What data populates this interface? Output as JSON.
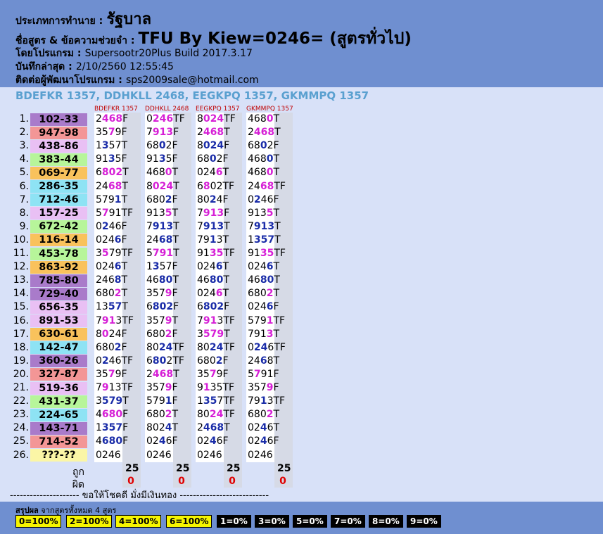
{
  "header": {
    "bet_label": "ประเภทการทำนาย :",
    "bet_value": "รัฐบาล",
    "formula_label": "ชื่อสูตร & ข้อความช่วยจำ :",
    "formula_value": "TFU By Kiew=0246= (สูตรทั่วไป)",
    "program_label": "โดยโปรแกรม :",
    "program_value": "Supersootr20Plus Build 2017.3.17",
    "saved_label": "บันทึกล่าสุด :",
    "saved_value": "2/10/2560 12:55:45",
    "contact_label": "ติดต่อผู้พัฒนาโปรแกรม :",
    "contact_value": "sps2009sale@hotmail.com"
  },
  "formula_line": "BDEFKR 1357, DDHKLL 2468, EEGKPQ 1357, GKMMPQ 1357",
  "columns": [
    "BDEFKR 1357",
    "DDHKLL 2468",
    "EEGKPQ 1357",
    "GKMMPQ 1357"
  ],
  "colors": {
    "pink": "#e9c0f4",
    "red": "#f39696",
    "green": "#b7f59a",
    "orange": "#f9c25c",
    "purple": "#a97bca",
    "cyan": "#8ee3f4",
    "yellow": "#fbf6a6"
  },
  "rows": [
    {
      "idx": "1.",
      "num": "102-33",
      "color": "purple",
      "cells": [
        [
          "2",
          "468",
          "F"
        ],
        [
          "0",
          "246",
          "TF"
        ],
        [
          "8",
          "024",
          "TF"
        ],
        [
          "468",
          "0",
          "T"
        ]
      ]
    },
    {
      "idx": "2.",
      "num": "947-98",
      "color": "red",
      "cells": [
        [
          "35",
          "7",
          "9F"
        ],
        [
          "7",
          "913",
          "F"
        ],
        [
          "2",
          "468",
          "T"
        ],
        [
          "2",
          "468",
          "T"
        ]
      ]
    },
    {
      "idx": "3.",
      "num": "438-86",
      "color": "pink",
      "cells": [
        [
          "1",
          "3",
          "57T"
        ],
        [
          "68",
          "0",
          "2F"
        ],
        [
          "8",
          "024",
          "F"
        ],
        [
          "68",
          "0",
          "2F"
        ]
      ]
    },
    {
      "idx": "4.",
      "num": "383-44",
      "color": "green",
      "cells": [
        [
          "91",
          "3",
          "5F"
        ],
        [
          "91",
          "3",
          "5F"
        ],
        [
          "68",
          "0",
          "2F"
        ],
        [
          "468",
          "0",
          "T"
        ]
      ]
    },
    {
      "idx": "5.",
      "num": "069-77",
      "color": "orange",
      "cells": [
        [
          "6",
          "802",
          "T"
        ],
        [
          "468",
          "0",
          "T"
        ],
        [
          "024",
          "6",
          "T"
        ],
        [
          "468",
          "0",
          "T"
        ]
      ]
    },
    {
      "idx": "6.",
      "num": "286-35",
      "color": "cyan",
      "cells": [
        [
          "24",
          "68",
          "T"
        ],
        [
          "8",
          "024",
          "T"
        ],
        [
          "6",
          "8",
          "02TF"
        ],
        [
          "24",
          "68",
          "TF"
        ]
      ]
    },
    {
      "idx": "7.",
      "num": "712-46",
      "color": "cyan",
      "cells": [
        [
          "579",
          "1",
          "T"
        ],
        [
          "680",
          "2",
          "F"
        ],
        [
          "80",
          "2",
          "4F"
        ],
        [
          "0",
          "2",
          "46F"
        ]
      ]
    },
    {
      "idx": "8.",
      "num": "157-25",
      "color": "pink",
      "cells": [
        [
          "5",
          "7",
          "91TF"
        ],
        [
          "913",
          "5",
          "T"
        ],
        [
          "7",
          "913",
          "F"
        ],
        [
          "913",
          "5",
          "T"
        ]
      ]
    },
    {
      "idx": "9.",
      "num": "672-42",
      "color": "green",
      "cells": [
        [
          "0",
          "2",
          "46F"
        ],
        [
          "7",
          "913",
          "T"
        ],
        [
          "7",
          "913",
          "T"
        ],
        [
          "7",
          "913",
          "T"
        ]
      ]
    },
    {
      "idx": "10.",
      "num": "116-14",
      "color": "orange",
      "cells": [
        [
          "024",
          "6",
          "F"
        ],
        [
          "24",
          "68",
          "T"
        ],
        [
          "79",
          "1",
          "3T"
        ],
        [
          "1",
          "357",
          "T"
        ]
      ]
    },
    {
      "idx": "11.",
      "num": "453-78",
      "color": "green",
      "cells": [
        [
          "3",
          "5",
          "79TF"
        ],
        [
          "5",
          "791",
          "T"
        ],
        [
          "91",
          "35",
          "TF"
        ],
        [
          "91",
          "35",
          "TF"
        ]
      ]
    },
    {
      "idx": "12.",
      "num": "863-92",
      "color": "orange",
      "cells": [
        [
          "024",
          "6",
          "T"
        ],
        [
          "1",
          "3",
          "57F"
        ],
        [
          "024",
          "6",
          "T"
        ],
        [
          "024",
          "6",
          "T"
        ]
      ]
    },
    {
      "idx": "13.",
      "num": "785-80",
      "color": "purple",
      "cells": [
        [
          "246",
          "8",
          "T"
        ],
        [
          "46",
          "80",
          "T"
        ],
        [
          "46",
          "80",
          "T"
        ],
        [
          "46",
          "80",
          "T"
        ]
      ]
    },
    {
      "idx": "14.",
      "num": "729-40",
      "color": "purple",
      "cells": [
        [
          "680",
          "2",
          "T"
        ],
        [
          "357",
          "9",
          "F"
        ],
        [
          "024",
          "6",
          "T"
        ],
        [
          "680",
          "2",
          "T"
        ]
      ]
    },
    {
      "idx": "15.",
      "num": "656-35",
      "color": "pink",
      "cells": [
        [
          "13",
          "57",
          "T"
        ],
        [
          "6",
          "802",
          "F"
        ],
        [
          "6",
          "802",
          "F"
        ],
        [
          "024",
          "6",
          "F"
        ]
      ]
    },
    {
      "idx": "16.",
      "num": "891-53",
      "color": "pink",
      "cells": [
        [
          "7",
          "91",
          "3TF"
        ],
        [
          "357",
          "9",
          "T"
        ],
        [
          "7",
          "91",
          "3TF"
        ],
        [
          "579",
          "1",
          "TF"
        ]
      ]
    },
    {
      "idx": "17.",
      "num": "630-61",
      "color": "orange",
      "cells": [
        [
          "8",
          "0",
          "24F"
        ],
        [
          "680",
          "2",
          "F"
        ],
        [
          "3",
          "579",
          "T"
        ],
        [
          "791",
          "3",
          "T"
        ]
      ]
    },
    {
      "idx": "18.",
      "num": "142-47",
      "color": "cyan",
      "cells": [
        [
          "680",
          "2",
          "F"
        ],
        [
          "80",
          "24",
          "TF"
        ],
        [
          "80",
          "24",
          "TF"
        ],
        [
          "0",
          "24",
          "6TF"
        ]
      ]
    },
    {
      "idx": "19.",
      "num": "360-26",
      "color": "purple",
      "cells": [
        [
          "0",
          "2",
          "46TF"
        ],
        [
          "6",
          "80",
          "2TF"
        ],
        [
          "680",
          "2",
          "F"
        ],
        [
          "24",
          "6",
          "8T"
        ]
      ]
    },
    {
      "idx": "20.",
      "num": "327-87",
      "color": "red",
      "cells": [
        [
          "35",
          "7",
          "9F"
        ],
        [
          "2",
          "468",
          "T"
        ],
        [
          "35",
          "7",
          "9F"
        ],
        [
          "5",
          "7",
          "91F"
        ]
      ]
    },
    {
      "idx": "21.",
      "num": "519-36",
      "color": "pink",
      "cells": [
        [
          "7",
          "9",
          "13TF"
        ],
        [
          "357",
          "9",
          "F"
        ],
        [
          "9",
          "1",
          "35TF"
        ],
        [
          "357",
          "9",
          "F"
        ]
      ]
    },
    {
      "idx": "22.",
      "num": "431-37",
      "color": "green",
      "cells": [
        [
          "3",
          "579",
          "T"
        ],
        [
          "579",
          "1",
          "F"
        ],
        [
          "1",
          "35",
          "7TF"
        ],
        [
          "79",
          "1",
          "3TF"
        ]
      ]
    },
    {
      "idx": "23.",
      "num": "224-65",
      "color": "cyan",
      "cells": [
        [
          "4",
          "680",
          "F"
        ],
        [
          "680",
          "2",
          "T"
        ],
        [
          "80",
          "24",
          "TF"
        ],
        [
          "680",
          "2",
          "T"
        ]
      ]
    },
    {
      "idx": "24.",
      "num": "143-71",
      "color": "purple",
      "cells": [
        [
          "1",
          "357",
          "F"
        ],
        [
          "802",
          "4",
          "T"
        ],
        [
          "2",
          "468",
          "T"
        ],
        [
          "02",
          "4",
          "6T"
        ]
      ]
    },
    {
      "idx": "25.",
      "num": "714-52",
      "color": "red",
      "cells": [
        [
          "4",
          "680",
          "F"
        ],
        [
          "02",
          "4",
          "6F"
        ],
        [
          "02",
          "4",
          "6F"
        ],
        [
          "02",
          "4",
          "6F"
        ]
      ]
    },
    {
      "idx": "26.",
      "num": "???-??",
      "color": "yellow",
      "cells": [
        [
          "",
          "0246",
          ""
        ],
        [
          "",
          "0246",
          ""
        ],
        [
          "",
          "0246",
          ""
        ],
        [
          "",
          "0246",
          ""
        ]
      ]
    }
  ],
  "summary": {
    "right_label": "ถูก",
    "wrong_label": "ผิด",
    "right": [
      "25",
      "25",
      "25",
      "25"
    ],
    "wrong": [
      "0",
      "0",
      "0",
      "0"
    ]
  },
  "luck_text": "--------------------- ขอให้โชคดี มั่งมีเงินทอง ---------------------------",
  "footer": {
    "summary_label": "สรุปผล",
    "summary_text": "จากสูตรทั้งหมด 4 สูตร",
    "badges": [
      {
        "label": "0=100%",
        "style": "y"
      },
      {
        "label": "2=100%",
        "style": "y"
      },
      {
        "label": "4=100%",
        "style": "y"
      },
      {
        "label": "6=100%",
        "style": "y"
      },
      {
        "label": "1=0%",
        "style": "k"
      },
      {
        "label": "3=0%",
        "style": "k"
      },
      {
        "label": "5=0%",
        "style": "k"
      },
      {
        "label": "7=0%",
        "style": "k"
      },
      {
        "label": "8=0%",
        "style": "k"
      },
      {
        "label": "9=0%",
        "style": "k"
      }
    ]
  }
}
